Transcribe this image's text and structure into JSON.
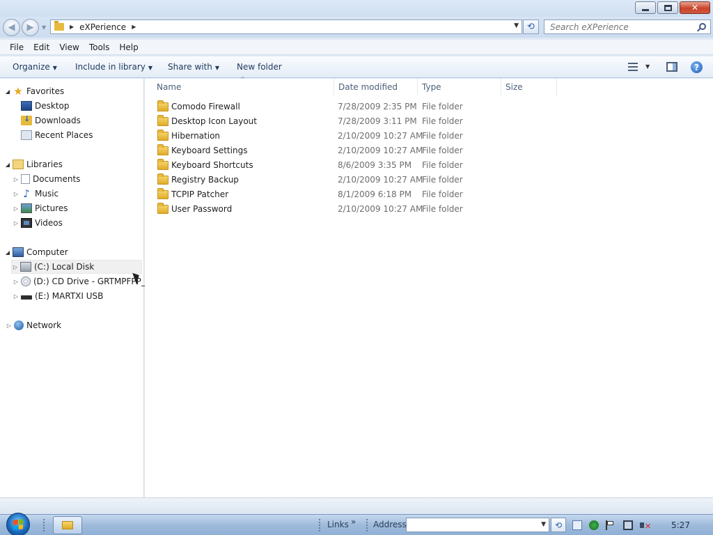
{
  "window": {
    "minimize_icon": "minimize-icon",
    "maximize_icon": "restore-icon",
    "close_label": "✕"
  },
  "nav": {
    "back_icon": "back-arrow-icon",
    "forward_icon": "forward-arrow-icon",
    "breadcrumb": [
      "eXPerience"
    ],
    "search_placeholder": "Search eXPerience"
  },
  "menu": [
    "File",
    "Edit",
    "View",
    "Tools",
    "Help"
  ],
  "toolbar": {
    "organize": "Organize",
    "include_in_library": "Include in library",
    "share_with": "Share with",
    "new_folder": "New folder"
  },
  "sidebar": {
    "favorites": "Favorites",
    "favorites_items": [
      "Desktop",
      "Downloads",
      "Recent Places"
    ],
    "libraries": "Libraries",
    "libraries_items": [
      "Documents",
      "Music",
      "Pictures",
      "Videos"
    ],
    "computer": "Computer",
    "computer_items": [
      "(C:) Local Disk",
      "(D:) CD Drive - GRTMPFPP_",
      "(E:) MARTXI USB"
    ],
    "network": "Network"
  },
  "columns": {
    "name": "Name",
    "date_modified": "Date modified",
    "type": "Type",
    "size": "Size"
  },
  "files": [
    {
      "name": "Comodo Firewall",
      "date": "7/28/2009 2:35 PM",
      "type": "File folder"
    },
    {
      "name": "Desktop Icon Layout",
      "date": "7/28/2009 3:11 PM",
      "type": "File folder"
    },
    {
      "name": "Hibernation",
      "date": "2/10/2009 10:27 AM",
      "type": "File folder"
    },
    {
      "name": "Keyboard Settings",
      "date": "2/10/2009 10:27 AM",
      "type": "File folder"
    },
    {
      "name": "Keyboard Shortcuts",
      "date": "8/6/2009 3:35 PM",
      "type": "File folder"
    },
    {
      "name": "Registry Backup",
      "date": "2/10/2009 10:27 AM",
      "type": "File folder"
    },
    {
      "name": "TCPIP Patcher",
      "date": "8/1/2009 6:18 PM",
      "type": "File folder"
    },
    {
      "name": "User Password",
      "date": "2/10/2009 10:27 AM",
      "type": "File folder"
    }
  ],
  "taskbar": {
    "links": "Links",
    "chevron": "»",
    "address_label": "Address",
    "address_value": "",
    "clock": "5:27"
  },
  "colors": {
    "accent": "#1d5fb9",
    "folder": "#e7b93d",
    "close_button": "#c8442b"
  }
}
